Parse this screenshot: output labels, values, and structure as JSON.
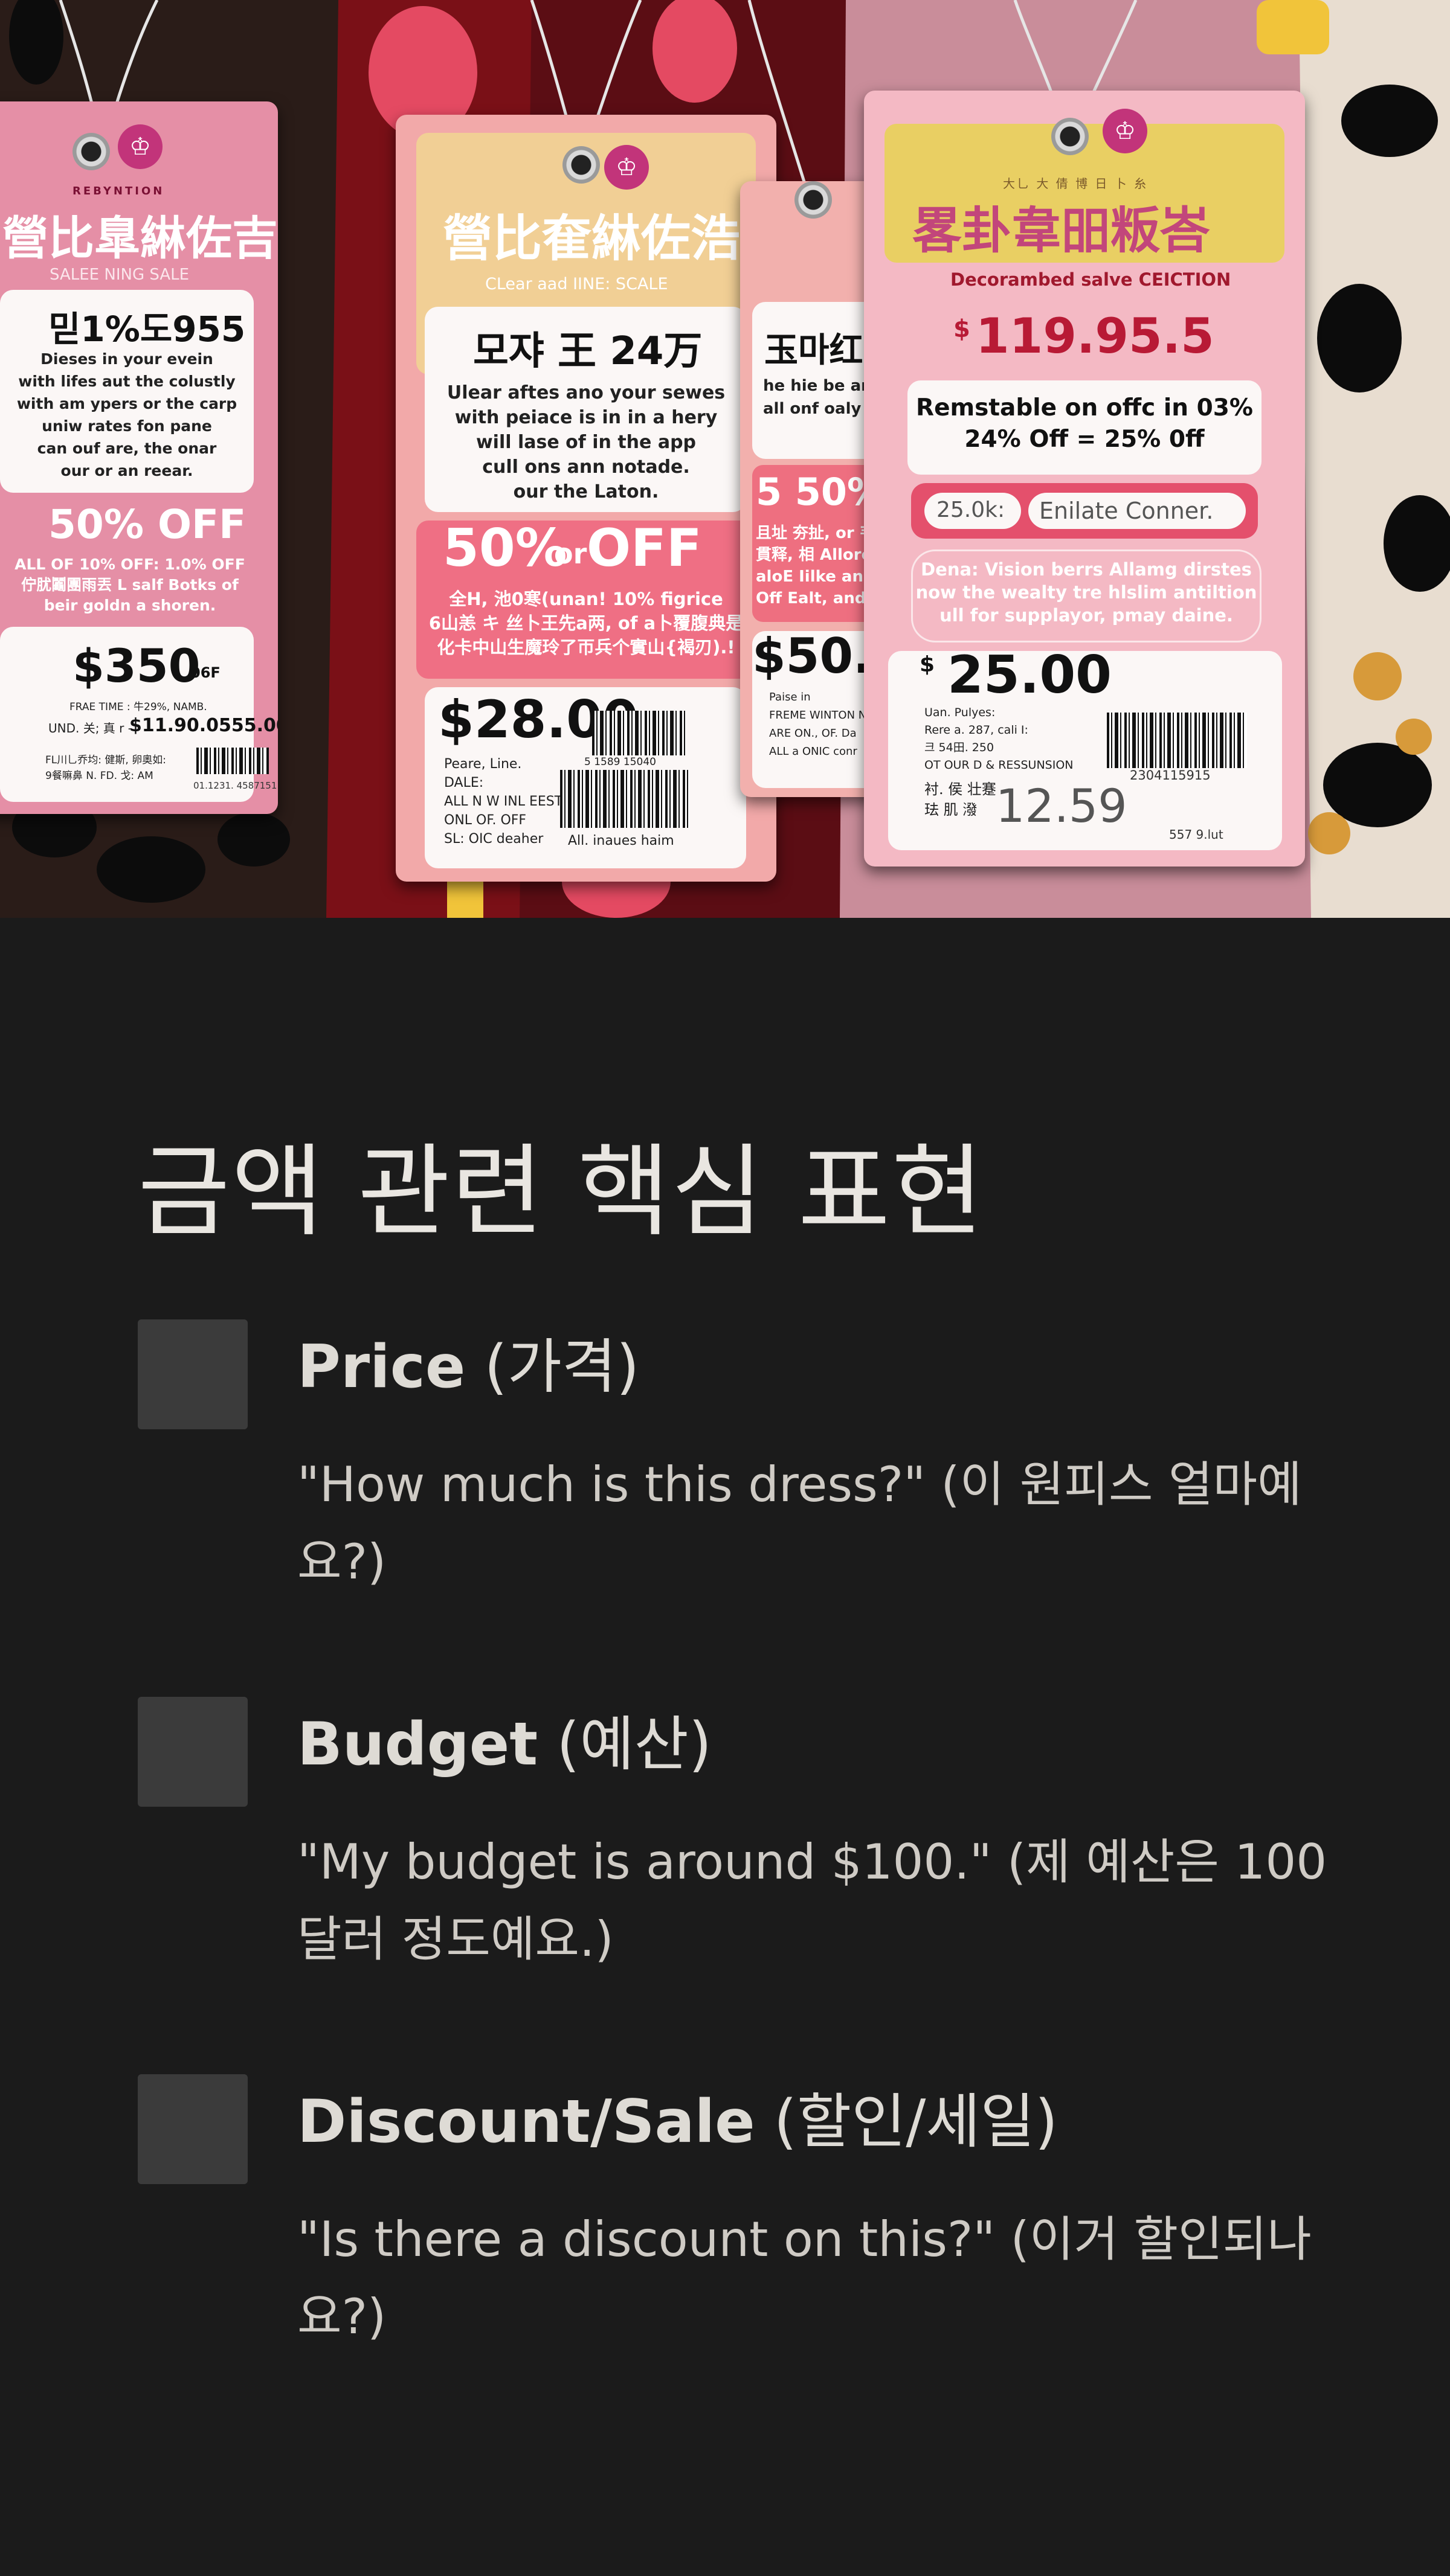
{
  "hero": {
    "tag1": {
      "brand_top": "REBYNTION",
      "brand_cjk": "營比臯綝佐吉",
      "subtitle": "SALEE NING SALE",
      "headline": "믿1%도955",
      "body": [
        "Dieses in your evein",
        "with lifes aut the colustly",
        "with am ypers or the carp",
        "uniw rates fon pane",
        "can ouf are, the onar",
        "our or an reear."
      ],
      "discount": "50% OFF",
      "discount_detail": [
        "ALL OF 10% OFF: 1.0% OFF",
        "佇肬鬮團雨丟 L salf Botks of",
        "beir goldn a shoren."
      ],
      "price": "$350",
      "price_suffix": "06F",
      "line1": "FRAE TIME : 牛29%, NAMB.",
      "line2_label": "UND. 关; 真 r -",
      "line2_value": "$11.90.0555.00",
      "footer_left": [
        "FL川乚乔均: 健斯, 卵奧如:",
        "9餐嘛鼻 N. FD. 戈: AM"
      ],
      "footer_code": "01.1231. 4587151"
    },
    "tag2": {
      "brand_cjk": "營比奞綝佐浩",
      "subtitle": "CLear aad IINE: SCALE",
      "headline": "모쟈 王 24万",
      "body": [
        "Ulear aftes ano your sewes",
        "with peiace is in in a hery",
        "will lase of in the app",
        "cull ons ann notade.",
        "our the Laton."
      ],
      "discount": "50%",
      "discount_or": "or",
      "discount_off": "OFF",
      "discount_detail": [
        "全H, 池0寒(unan! 10% figrice",
        "6山恙 キ 丝卜王先a两, of a卜覆腹典是",
        "化卡中山生魔玲了帀兵个實山{褐刃).!"
      ],
      "price": "$28.00",
      "barcode_num": "5 1589 15040",
      "meta": [
        "Peare, Line.",
        "DALE:",
        "ALL N W INL EEST",
        "ONL OF. OFF",
        "SL: OIC deaher"
      ],
      "footer": "All. inaues haim"
    },
    "tag3": {
      "headline": "玉마红",
      "body": [
        "he hie be anr",
        "all onf oaly"
      ],
      "discount": "5 50%",
      "discount_detail": [
        "且址 夯扯, or 韦月",
        "貫释, 相 Allore of",
        "aloE Iilke anpel",
        "Off Ealt, and"
      ],
      "price": "$50.",
      "meta": [
        "Paise in",
        "FREME WINTON NE",
        "ARE ON., OF. Da",
        "ALL a ONIC conr"
      ]
    },
    "tag4": {
      "brand_small": "大乚 大 倩 博 日 卜 糸",
      "brand_cjk": "畧卦韋昍粄峇",
      "subtitle": "Decorambed salve CEICTION",
      "price_top": "119.95.5",
      "notice": [
        "Remstable on offc in 03%",
        "24%  Off = 25% 0ff"
      ],
      "chip": "25.0k:",
      "field": "Enilate Conner.",
      "desc": [
        "Dena: Vision berrs Allamg dirstes",
        "now the wealty tre hlslim antiltion",
        "ull for  supplayor, pmay daine."
      ],
      "price_main": "25.00",
      "meta": [
        "Uan. Pulyes:",
        "Rere a. 287, cali I:",
        "크 54田. 250",
        "OT OUR D & RESSUNSION"
      ],
      "barcode_num": "2304115915",
      "cjk_lines": [
        "衬. 侯 壮蹇",
        "珐 肌 潑"
      ],
      "price_small": "12.59",
      "footer": "557 9.lut"
    }
  },
  "content": {
    "title": "금액 관련 핵심 표현",
    "items": [
      {
        "term": "Price",
        "term_ko": "(가격)",
        "example": "\"How much is this dress?\" (이 원피스 얼마예요?)"
      },
      {
        "term": "Budget",
        "term_ko": "(예산)",
        "example": "\"My budget is around $100.\" (제 예산은 100달러 정도예요.)"
      },
      {
        "term": "Discount/Sale",
        "term_ko": "(할인/세일)",
        "example": "\"Is there a discount on this?\" (이거 할인되나요?)"
      }
    ]
  }
}
